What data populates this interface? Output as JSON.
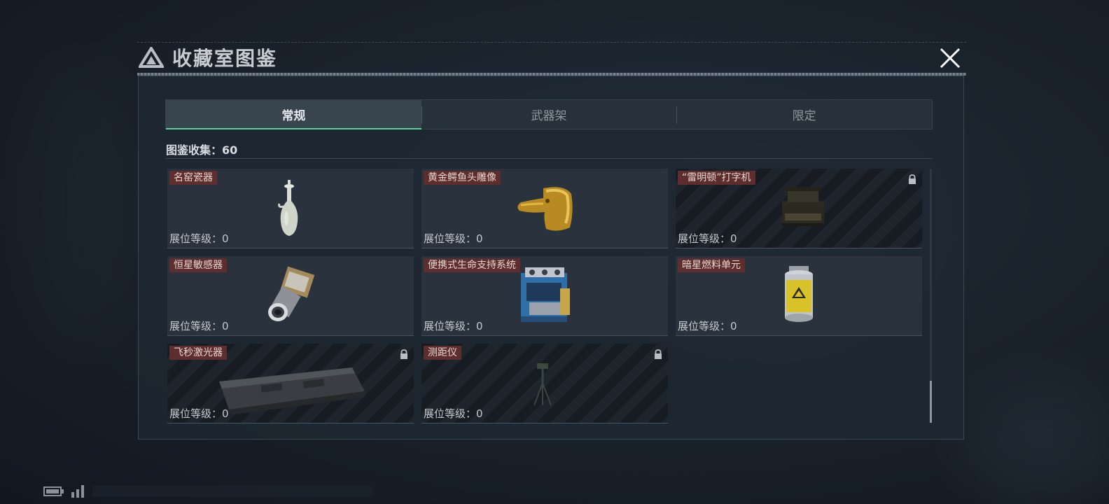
{
  "window": {
    "title": "收藏室图鉴",
    "logo_icon": "triangle-logo-icon",
    "close_icon": "close-icon"
  },
  "tabs": [
    {
      "label": "常规",
      "active": true
    },
    {
      "label": "武器架",
      "active": false
    },
    {
      "label": "限定",
      "active": false
    }
  ],
  "collection": {
    "label": "图鉴收集：",
    "value": "60"
  },
  "level_label": "展位等级：",
  "items": [
    {
      "name": "名窑瓷器",
      "level": "0",
      "locked": false,
      "art": "vase-icon"
    },
    {
      "name": "黄金鳄鱼头雕像",
      "level": "0",
      "locked": false,
      "art": "golden-crocodile-head-icon"
    },
    {
      "name": "“雷明顿”打字机",
      "level": "0",
      "locked": true,
      "art": "typewriter-icon"
    },
    {
      "name": "恒星敏感器",
      "level": "0",
      "locked": false,
      "art": "star-sensor-icon"
    },
    {
      "name": "便携式生命支持系统",
      "level": "0",
      "locked": false,
      "art": "life-support-system-icon"
    },
    {
      "name": "暗星燃料单元",
      "level": "0",
      "locked": false,
      "art": "fuel-canister-icon"
    },
    {
      "name": "飞秒激光器",
      "level": "0",
      "locked": true,
      "art": "laser-case-icon"
    },
    {
      "name": "测距仪",
      "level": "0",
      "locked": true,
      "art": "rangefinder-tripod-icon"
    }
  ],
  "colors": {
    "accent": "#5fcf9a",
    "name_badge": "#5e2d2d",
    "panel": "#1e2832"
  },
  "scrollbar": {
    "position": "bottom"
  }
}
